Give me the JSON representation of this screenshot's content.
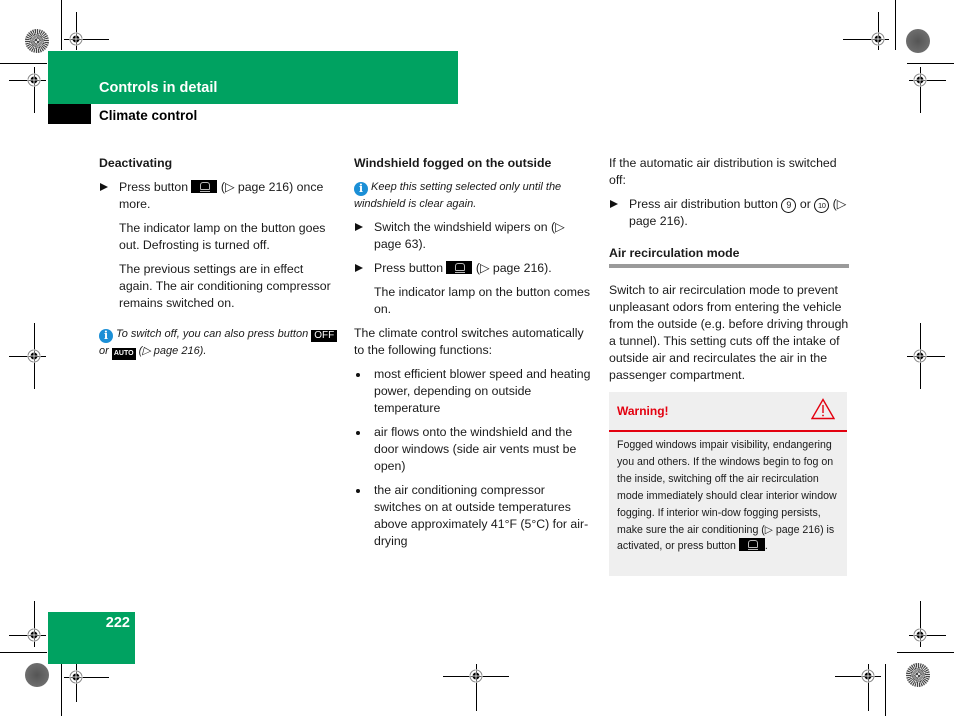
{
  "header": {
    "section": "Controls in detail",
    "subsection": "Climate control"
  },
  "page_number": "222",
  "colors": {
    "brand_green": "#00a261",
    "warning_red": "#e3000f",
    "info_blue": "#1b8fd6"
  },
  "column1": {
    "heading": "Deactivating",
    "step1_pre": "Press button",
    "step1_post": " (▷ page 216) once more.",
    "para1": "The indicator lamp on the button goes out. Defrosting is turned off.",
    "para2": "The previous settings are in effect again. The air conditioning compressor remains switched on.",
    "note_pre": "To switch off, you can also press button",
    "note_btn1": "OFF",
    "note_mid": "or",
    "note_btn2": "AUTO",
    "note_post": "(▷ page 216)."
  },
  "column2": {
    "heading": "Windshield fogged on the outside",
    "note": "Keep this setting selected only until the windshield is clear again.",
    "step1": "Switch the windshield wipers on (▷ page 63).",
    "step2_pre": "Press button",
    "step2_post": " (▷ page 216).",
    "para1": "The indicator lamp on the button comes on.",
    "para2": "The climate control switches automatically to the following functions:",
    "bullets": [
      "most efficient blower speed and heating power, depending on outside temperature",
      "air flows onto the windshield and the door windows (side air vents must be open)",
      "the air conditioning compressor switches on at outside temperatures above approximately 41°F (5°C) for air-drying"
    ]
  },
  "column3": {
    "intro": "If the automatic air distribution is switched off:",
    "step1_pre": "Press air distribution button",
    "step1_num1": "9",
    "step1_mid": "or",
    "step1_num2": "10",
    "step1_post": "(▷ page 216).",
    "heading": "Air recirculation mode",
    "para": "Switch to air recirculation mode to prevent unpleasant odors from entering the vehicle from the outside (e.g. before driving through a tunnel). This setting cuts off the intake of outside air and recirculates the air in the passenger compartment."
  },
  "warning": {
    "title": "Warning!",
    "body": "Fogged windows impair visibility, endangering you and others. If the windows begin to fog on the inside, switching off the air recirculation mode immediately should clear interior window fogging. If interior win-dow fogging persists, make sure the air conditioning (▷ page 216) is activated, or press button",
    "body_end": "."
  },
  "icons": {
    "info": "info-icon",
    "warning": "warning-triangle-icon",
    "defrost_button": "defrost-button-icon",
    "step_marker": "triangle-right-icon"
  }
}
